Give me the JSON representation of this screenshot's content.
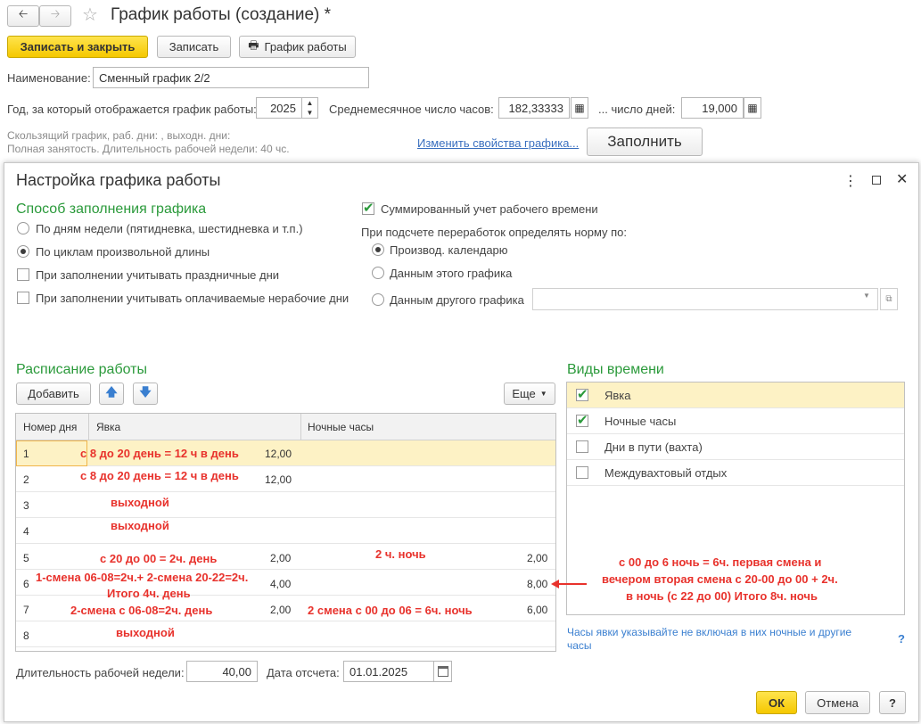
{
  "window": {
    "title": "График работы (создание) *",
    "buttons": {
      "save_close": "Записать и закрыть",
      "save": "Записать",
      "schedule": "График работы"
    },
    "name_label": "Наименование:",
    "name_value": "Сменный график 2/2",
    "year_label": "Год, за который отображается график работы:",
    "year_value": "2025",
    "avg_hours_label": "Среднемесячное число часов:",
    "avg_hours_value": "182,33333",
    "days_label": "... число дней:",
    "days_value": "19,000",
    "desc_line1": "Скользящий график, раб. дни: , выходн. дни:",
    "desc_line2": "Полная занятость. Длительность рабочей недели: 40 чс.",
    "change_link": "Изменить свойства графика...",
    "fill_button": "Заполнить"
  },
  "dialog": {
    "title": "Настройка графика работы",
    "fill_method_title": "Способ заполнения графика",
    "opt_weekdays": "По дням недели (пятидневка, шестидневка и т.п.)",
    "opt_cycles": "По циклам произвольной длины",
    "chk_holidays": "При заполнении учитывать праздничные дни",
    "chk_paid_nonworking": "При заполнении учитывать оплачиваемые нерабочие дни",
    "chk_summarized": "Суммированный учет рабочего времени",
    "norm_label": "При подсчете переработок определять норму по:",
    "norm_opt1": "Производ. календарю",
    "norm_opt2": "Данным этого графика",
    "norm_opt3": "Данным другого графика",
    "schedule_title": "Расписание работы",
    "add_button": "Добавить",
    "more_button": "Еще",
    "columns": [
      "Номер дня",
      "Явка",
      "Ночные часы"
    ],
    "rows": [
      {
        "day": "1",
        "attendance": "12,00",
        "night": ""
      },
      {
        "day": "2",
        "attendance": "12,00",
        "night": ""
      },
      {
        "day": "3",
        "attendance": "",
        "night": ""
      },
      {
        "day": "4",
        "attendance": "",
        "night": ""
      },
      {
        "day": "5",
        "attendance": "2,00",
        "night": "2,00"
      },
      {
        "day": "6",
        "attendance": "4,00",
        "night": "8,00"
      },
      {
        "day": "7",
        "attendance": "2,00",
        "night": "6,00"
      },
      {
        "day": "8",
        "attendance": "",
        "night": ""
      }
    ],
    "time_types_title": "Виды времени",
    "time_types": [
      {
        "label": "Явка",
        "checked": true
      },
      {
        "label": "Ночные часы",
        "checked": true
      },
      {
        "label": "Дни в пути (вахта)",
        "checked": false
      },
      {
        "label": "Междувахтовый отдых",
        "checked": false
      }
    ],
    "hint_text_line1": "Часы явки указывайте не включая в них ночные и другие",
    "hint_text_line2": "часы",
    "hint_q": "?",
    "week_length_label": "Длительность рабочей недели:",
    "week_length_value": "40,00",
    "ref_date_label": "Дата отсчета:",
    "ref_date_value": "01.01.2025",
    "ok_button": "ОК",
    "cancel_button": "Отмена",
    "help_button": "?"
  },
  "annotations": {
    "row1": "с 8 до 20 день = 12 ч  в день",
    "row2": "с 8 до 20 день = 12 ч  в день",
    "row3": "выходной",
    "row4": "выходной",
    "row5_day": "с 20 до 00 = 2ч. день",
    "row5_night": "2 ч. ночь",
    "row6_line1": "1-смена 06-08=2ч.+ 2-смена 20-22=2ч.",
    "row6_line2": "Итого 4ч. день",
    "row7_day": "2-смена с 06-08=2ч. день",
    "row7_night": "2 смена с 00 до 06 = 6ч. ночь",
    "row8": "выходной",
    "side_line1": "с 00 до 6 ночь = 6ч. первая смена и",
    "side_line2": "вечером вторая смена с 20-00 до 00 + 2ч.",
    "side_line3": "в ночь (с 22 до 00) Итого 8ч. ночь"
  },
  "colors": {
    "accent_green": "#2b9a3b",
    "annotation_red": "#e8322c",
    "selected_row": "#fdf2c5",
    "primary_button": "#f5c800",
    "link": "#3a6fbf"
  }
}
